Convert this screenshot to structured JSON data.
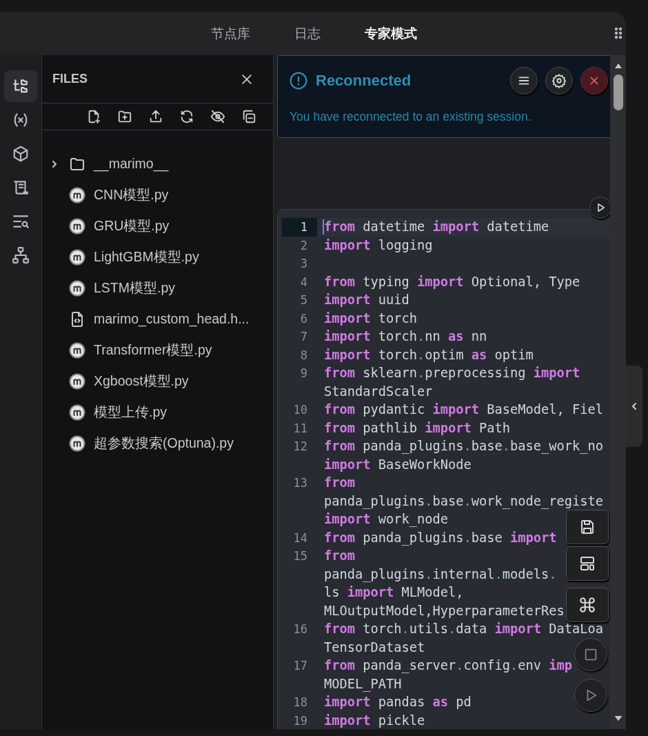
{
  "header": {
    "tabs": [
      {
        "label": "节点库",
        "selected": false
      },
      {
        "label": "日志",
        "selected": false
      },
      {
        "label": "专家模式",
        "selected": true
      }
    ]
  },
  "activity_bar": {
    "items": [
      {
        "selected": true
      },
      {
        "selected": false
      },
      {
        "selected": false
      },
      {
        "selected": false
      },
      {
        "selected": false
      },
      {
        "selected": false
      }
    ]
  },
  "files_panel": {
    "title": "FILES",
    "tree": [
      {
        "kind": "folder",
        "name": "__marimo__",
        "expanded": false
      },
      {
        "kind": "notebook",
        "name": "CNN模型.py"
      },
      {
        "kind": "notebook",
        "name": "GRU模型.py"
      },
      {
        "kind": "notebook",
        "name": "LightGBM模型.py"
      },
      {
        "kind": "notebook",
        "name": "LSTM模型.py"
      },
      {
        "kind": "html",
        "name": "marimo_custom_head.h..."
      },
      {
        "kind": "notebook",
        "name": "Transformer模型.py"
      },
      {
        "kind": "notebook",
        "name": "Xgboost模型.py"
      },
      {
        "kind": "notebook",
        "name": "模型上传.py"
      },
      {
        "kind": "notebook",
        "name": "超参数搜索(Optuna).py"
      }
    ]
  },
  "notification": {
    "title": "Reconnected",
    "message": "You have reconnected to an existing session."
  },
  "editor": {
    "lines": [
      {
        "number": "1",
        "current": true,
        "wrap_lines": [
          {
            "segments": [
              {
                "kind": "keyword",
                "text": "from"
              },
              {
                "kind": "name",
                "text": " datetime "
              },
              {
                "kind": "keyword",
                "text": "import"
              },
              {
                "kind": "name",
                "text": " datetime"
              }
            ]
          }
        ]
      },
      {
        "number": "2",
        "current": false,
        "wrap_lines": [
          {
            "segments": [
              {
                "kind": "keyword",
                "text": "import"
              },
              {
                "kind": "name",
                "text": " logging"
              }
            ]
          }
        ]
      },
      {
        "number": "3",
        "current": false
      },
      {
        "number": "4",
        "current": false,
        "wrap_lines": [
          {
            "segments": [
              {
                "kind": "keyword",
                "text": "from"
              },
              {
                "kind": "name",
                "text": " typing "
              },
              {
                "kind": "keyword",
                "text": "import"
              },
              {
                "kind": "name",
                "text": " Optional, Type"
              }
            ]
          }
        ]
      },
      {
        "number": "5",
        "current": false,
        "wrap_lines": [
          {
            "segments": [
              {
                "kind": "keyword",
                "text": "import"
              },
              {
                "kind": "name",
                "text": " uuid"
              }
            ]
          }
        ]
      },
      {
        "number": "6",
        "current": false,
        "wrap_lines": [
          {
            "segments": [
              {
                "kind": "keyword",
                "text": "import"
              },
              {
                "kind": "name",
                "text": " torch"
              }
            ]
          }
        ]
      },
      {
        "number": "7",
        "current": false,
        "wrap_lines": [
          {
            "segments": [
              {
                "kind": "keyword",
                "text": "import"
              },
              {
                "kind": "path",
                "text": " torch.nn "
              },
              {
                "kind": "keyword",
                "text": "as"
              },
              {
                "kind": "name",
                "text": " nn"
              }
            ]
          }
        ]
      },
      {
        "number": "8",
        "current": false,
        "wrap_lines": [
          {
            "segments": [
              {
                "kind": "keyword",
                "text": "import"
              },
              {
                "kind": "path",
                "text": " torch.optim "
              },
              {
                "kind": "keyword",
                "text": "as"
              },
              {
                "kind": "name",
                "text": " optim"
              }
            ]
          }
        ]
      },
      {
        "number": "9",
        "current": false,
        "wrap_lines": [
          {
            "segments": [
              {
                "kind": "keyword",
                "text": "from"
              },
              {
                "kind": "path",
                "text": " sklearn.preprocessing "
              },
              {
                "kind": "keyword",
                "text": "import"
              }
            ]
          },
          {
            "segments": [
              {
                "kind": "name",
                "text": "StandardScaler"
              }
            ]
          }
        ]
      },
      {
        "number": "10",
        "current": false,
        "wrap_lines": [
          {
            "segments": [
              {
                "kind": "keyword",
                "text": "from"
              },
              {
                "kind": "name",
                "text": " pydantic "
              },
              {
                "kind": "keyword",
                "text": "import"
              },
              {
                "kind": "name",
                "text": " BaseModel, Fiel"
              }
            ]
          }
        ]
      },
      {
        "number": "11",
        "current": false,
        "wrap_lines": [
          {
            "segments": [
              {
                "kind": "keyword",
                "text": "from"
              },
              {
                "kind": "name",
                "text": " pathlib "
              },
              {
                "kind": "keyword",
                "text": "import"
              },
              {
                "kind": "name",
                "text": " Path"
              }
            ]
          }
        ]
      },
      {
        "number": "12",
        "current": false,
        "wrap_lines": [
          {
            "segments": [
              {
                "kind": "keyword",
                "text": "from"
              },
              {
                "kind": "path",
                "text": " panda_plugins.base.base_work_no"
              }
            ]
          },
          {
            "segments": [
              {
                "kind": "keyword",
                "text": "import"
              },
              {
                "kind": "name",
                "text": " BaseWorkNode"
              }
            ]
          }
        ]
      },
      {
        "number": "13",
        "current": false,
        "wrap_lines": [
          {
            "segments": [
              {
                "kind": "keyword",
                "text": "from"
              }
            ]
          },
          {
            "segments": [
              {
                "kind": "path",
                "text": "panda_plugins.base.work_node_registe"
              }
            ]
          },
          {
            "segments": [
              {
                "kind": "keyword",
                "text": "import"
              },
              {
                "kind": "name",
                "text": " work_node"
              }
            ]
          }
        ]
      },
      {
        "number": "14",
        "current": false,
        "wrap_lines": [
          {
            "segments": [
              {
                "kind": "keyword",
                "text": "from"
              },
              {
                "kind": "path",
                "text": " panda_plugins.base "
              },
              {
                "kind": "keyword",
                "text": "import"
              }
            ]
          }
        ]
      },
      {
        "number": "15",
        "current": false,
        "wrap_lines": [
          {
            "segments": [
              {
                "kind": "keyword",
                "text": "from"
              }
            ]
          },
          {
            "segments": [
              {
                "kind": "path",
                "text": "panda_plugins.internal.models."
              }
            ]
          },
          {
            "segments": [
              {
                "kind": "name",
                "text": "ls "
              },
              {
                "kind": "keyword",
                "text": "import"
              },
              {
                "kind": "name",
                "text": " MLModel,"
              }
            ]
          },
          {
            "segments": [
              {
                "kind": "name",
                "text": "MLOutputModel,HyperparameterRes"
              }
            ]
          }
        ]
      },
      {
        "number": "16",
        "current": false,
        "wrap_lines": [
          {
            "segments": [
              {
                "kind": "keyword",
                "text": "from"
              },
              {
                "kind": "path",
                "text": " torch.utils.data "
              },
              {
                "kind": "keyword",
                "text": "import"
              },
              {
                "kind": "name",
                "text": " DataLoa"
              }
            ]
          },
          {
            "segments": [
              {
                "kind": "name",
                "text": "TensorDataset"
              }
            ]
          }
        ]
      },
      {
        "number": "17",
        "current": false,
        "wrap_lines": [
          {
            "segments": [
              {
                "kind": "keyword",
                "text": "from"
              },
              {
                "kind": "path",
                "text": " panda_server.config.env "
              },
              {
                "kind": "keyword",
                "text": "imp"
              }
            ]
          },
          {
            "segments": [
              {
                "kind": "name",
                "text": "MODEL_PATH"
              }
            ]
          }
        ]
      },
      {
        "number": "18",
        "current": false,
        "wrap_lines": [
          {
            "segments": [
              {
                "kind": "keyword",
                "text": "import"
              },
              {
                "kind": "name",
                "text": " pandas "
              },
              {
                "kind": "keyword",
                "text": "as"
              },
              {
                "kind": "name",
                "text": " pd"
              }
            ]
          }
        ]
      },
      {
        "number": "19",
        "current": false,
        "wrap_lines": [
          {
            "segments": [
              {
                "kind": "keyword",
                "text": "import"
              },
              {
                "kind": "name",
                "text": " pickle"
              }
            ]
          }
        ]
      }
    ]
  }
}
